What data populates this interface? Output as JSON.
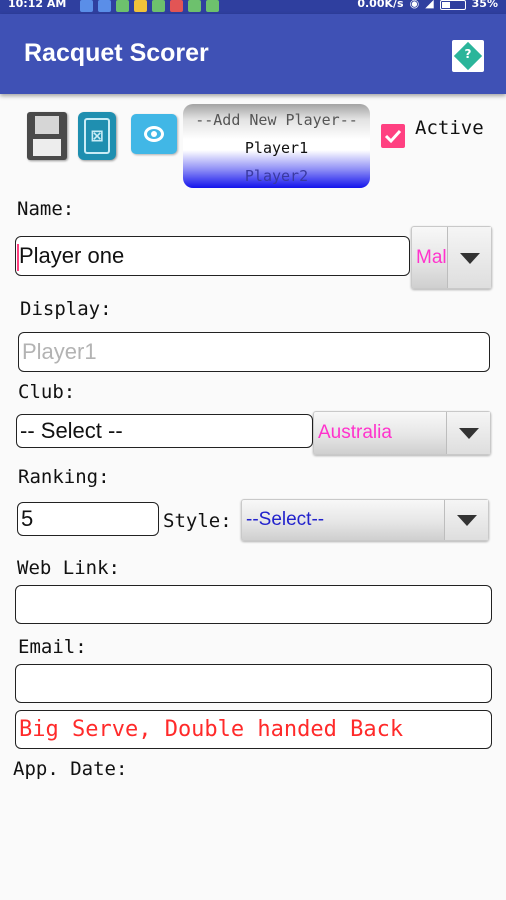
{
  "status_bar": {
    "time": "10:12 AM",
    "network_speed": "0.00K/s",
    "battery": "35%"
  },
  "app_bar": {
    "title": "Racquet Scorer",
    "help_icon": "help-diamond-icon"
  },
  "toolbar": {
    "icons": [
      "save-disk-icon",
      "xml-export-icon",
      "import-chip-icon"
    ]
  },
  "player_picker": {
    "items": [
      "--Add New Player--",
      "Player1",
      "Player2"
    ],
    "selected": "Player1"
  },
  "active": {
    "label": "Active",
    "checked": true
  },
  "form": {
    "name_label": "Name:",
    "name_value": "Player one",
    "gender_value": "Male",
    "display_label": "Display:",
    "display_placeholder": "Player1",
    "club_label": "Club:",
    "club_value": "-- Select --",
    "country_value": "Australia",
    "ranking_label": "Ranking:",
    "ranking_value": "5",
    "style_label": "Style:",
    "style_value": "--Select--",
    "weblink_label": "Web Link:",
    "weblink_value": "",
    "email_label": "Email:",
    "email_value": "",
    "notes_value": "Big Serve, Double handed Back",
    "app_date_label": "App. Date:"
  },
  "colors": {
    "app_bar": "#3f51b5",
    "status_bar": "#2f3f9f",
    "accent": "#ff4081",
    "spinner_text": "#ff33cc",
    "style_text": "#2222cc",
    "notes_text": "#ff2a2a"
  }
}
